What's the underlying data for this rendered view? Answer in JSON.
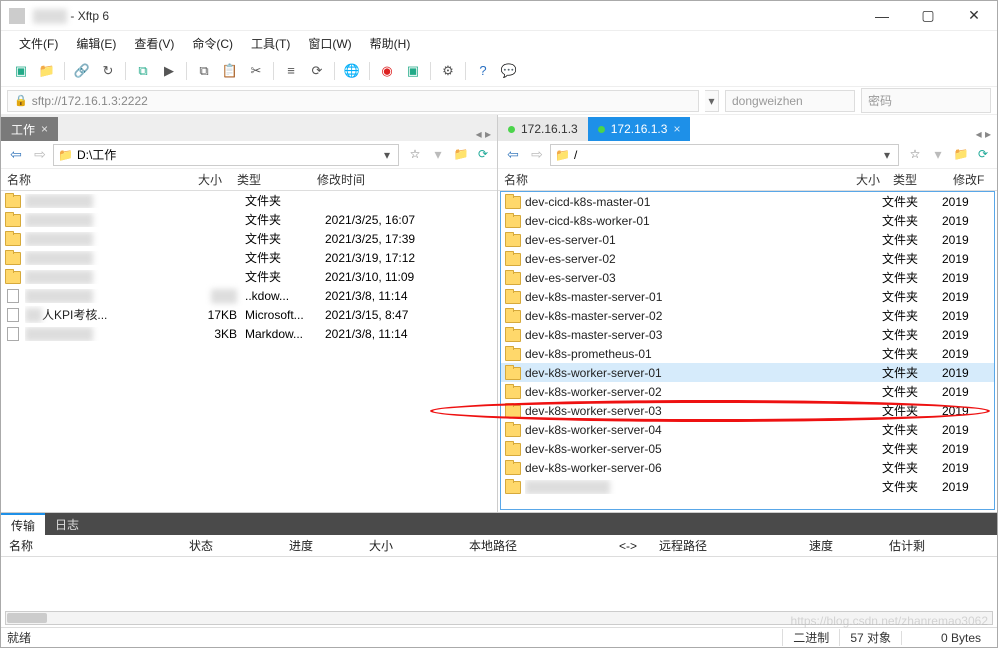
{
  "titlebar": {
    "app": "Xftp 6"
  },
  "menu": {
    "file": "文件(F)",
    "edit": "编辑(E)",
    "view": "查看(V)",
    "cmd": "命令(C)",
    "tool": "工具(T)",
    "window": "窗口(W)",
    "help": "帮助(H)"
  },
  "addr": {
    "url": "sftp://172.16.1.3:2222",
    "user": "dongweizhen",
    "pass": "密码"
  },
  "left": {
    "tab": "工作",
    "path": "D:\\工作",
    "cols": {
      "name": "名称",
      "size": "大小",
      "type": "类型",
      "date": "修改时间"
    },
    "rows": [
      {
        "icon": "folder",
        "name": "",
        "blur": true,
        "size": "",
        "type": "文件夹",
        "date": ""
      },
      {
        "icon": "folder",
        "name": "",
        "blur": true,
        "size": "",
        "type": "文件夹",
        "date": "2021/3/25, 16:07"
      },
      {
        "icon": "folder",
        "name": "",
        "blur": true,
        "size": "",
        "type": "文件夹",
        "date": "2021/3/25, 17:39"
      },
      {
        "icon": "folder",
        "name": "",
        "blur": true,
        "size": "",
        "type": "文件夹",
        "date": "2021/3/19, 17:12"
      },
      {
        "icon": "folder",
        "name": "",
        "blur": true,
        "size": "",
        "type": "文件夹",
        "date": "2021/3/10, 11:09"
      },
      {
        "icon": "file",
        "name": "",
        "blur": true,
        "size": "",
        "sizeblur": true,
        "type": "..kdow...",
        "date": "2021/3/8, 11:14"
      },
      {
        "icon": "file",
        "name": "人KPI考核...",
        "partialblur": true,
        "size": "17KB",
        "type": "Microsoft...",
        "date": "2021/3/15, 8:47"
      },
      {
        "icon": "file",
        "name": "",
        "blur": true,
        "size": "3KB",
        "type": "Markdow...",
        "date": "2021/3/8, 11:14"
      }
    ]
  },
  "right": {
    "tabs": [
      {
        "label": "172.16.1.3",
        "active": false
      },
      {
        "label": "172.16.1.3",
        "active": true
      }
    ],
    "path": "/",
    "cols": {
      "name": "名称",
      "size": "大小",
      "type": "类型",
      "date": "修改F"
    },
    "rows": [
      {
        "name": "dev-cicd-k8s-master-01",
        "type": "文件夹",
        "date": "2019"
      },
      {
        "name": "dev-cicd-k8s-worker-01",
        "type": "文件夹",
        "date": "2019"
      },
      {
        "name": "dev-es-server-01",
        "type": "文件夹",
        "date": "2019"
      },
      {
        "name": "dev-es-server-02",
        "type": "文件夹",
        "date": "2019"
      },
      {
        "name": "dev-es-server-03",
        "type": "文件夹",
        "date": "2019"
      },
      {
        "name": "dev-k8s-master-server-01",
        "type": "文件夹",
        "date": "2019"
      },
      {
        "name": "dev-k8s-master-server-02",
        "type": "文件夹",
        "date": "2019"
      },
      {
        "name": "dev-k8s-master-server-03",
        "type": "文件夹",
        "date": "2019"
      },
      {
        "name": "dev-k8s-prometheus-01",
        "type": "文件夹",
        "date": "2019"
      },
      {
        "name": "dev-k8s-worker-server-01",
        "type": "文件夹",
        "date": "2019",
        "sel": true
      },
      {
        "name": "dev-k8s-worker-server-02",
        "type": "文件夹",
        "date": "2019"
      },
      {
        "name": "dev-k8s-worker-server-03",
        "type": "文件夹",
        "date": "2019"
      },
      {
        "name": "dev-k8s-worker-server-04",
        "type": "文件夹",
        "date": "2019"
      },
      {
        "name": "dev-k8s-worker-server-05",
        "type": "文件夹",
        "date": "2019"
      },
      {
        "name": "dev-k8s-worker-server-06",
        "type": "文件夹",
        "date": "2019"
      },
      {
        "name": "",
        "blur": true,
        "type": "文件夹",
        "date": "2019"
      }
    ]
  },
  "transfer": {
    "tabs": {
      "transfer": "传输",
      "log": "日志"
    },
    "cols": {
      "name": "名称",
      "status": "状态",
      "progress": "进度",
      "size": "大小",
      "local": "本地路径",
      "arrow": "<->",
      "remote": "远程路径",
      "speed": "速度",
      "est": "估计剩"
    }
  },
  "status": {
    "ready": "就绪",
    "binary": "二进制",
    "objects": "57 对象",
    "bytes": "0 Bytes"
  },
  "watermark": "https://blog.csdn.net/zhanremao3062"
}
